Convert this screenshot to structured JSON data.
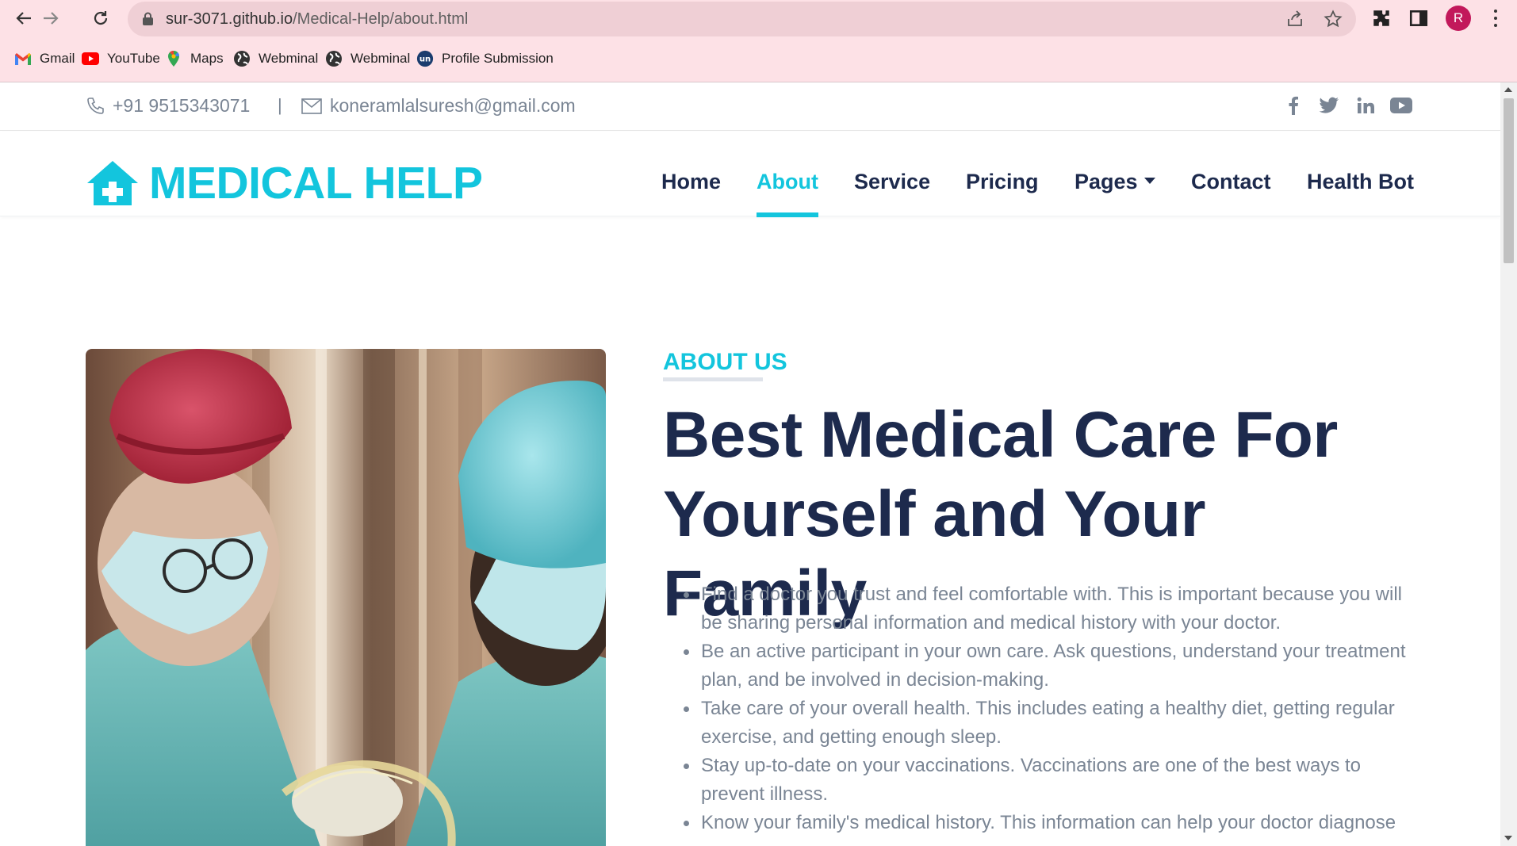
{
  "browser": {
    "url_host": "sur-3071.github.io",
    "url_path": "/Medical-Help/about.html",
    "profile_initial": "R",
    "bookmarks": [
      {
        "label": "Gmail",
        "icon": "gmail-icon"
      },
      {
        "label": "YouTube",
        "icon": "youtube-icon"
      },
      {
        "label": "Maps",
        "icon": "maps-icon"
      },
      {
        "label": "Webminal",
        "icon": "globe-icon"
      },
      {
        "label": "Webminal",
        "icon": "globe-icon"
      },
      {
        "label": "Profile Submission",
        "icon": "un-icon"
      }
    ]
  },
  "topbar": {
    "phone": "+91 9515343071",
    "separator": "|",
    "email": "koneramlalsuresh@gmail.com",
    "socials": [
      "facebook-icon",
      "twitter-icon",
      "linkedin-icon",
      "youtube-icon"
    ]
  },
  "navbar": {
    "brand": "MEDICAL HELP",
    "links": [
      {
        "label": "Home"
      },
      {
        "label": "About",
        "active": true
      },
      {
        "label": "Service"
      },
      {
        "label": "Pricing"
      },
      {
        "label": "Pages",
        "dropdown": true
      },
      {
        "label": "Contact"
      },
      {
        "label": "Health Bot"
      }
    ]
  },
  "about": {
    "label": "ABOUT US",
    "headline_line1": "Best Medical Care For",
    "headline_line2": "Yourself and Your Family",
    "bullets": [
      "Find a doctor you trust and feel comfortable with. This is important because you will be sharing personal information and medical history with your doctor.",
      "Be an active participant in your own care. Ask questions, understand your treatment plan, and be involved in decision-making.",
      "Take care of your overall health. This includes eating a healthy diet, getting regular exercise, and getting enough sleep.",
      "Stay up-to-date on your vaccinations. Vaccinations are one of the best ways to prevent illness.",
      "Know your family's medical history. This information can help your doctor diagnose"
    ]
  },
  "colors": {
    "accent": "#13c5dd",
    "navy": "#1d2a4d",
    "muted_text": "#7a8594",
    "chrome": "#fde1e6"
  }
}
